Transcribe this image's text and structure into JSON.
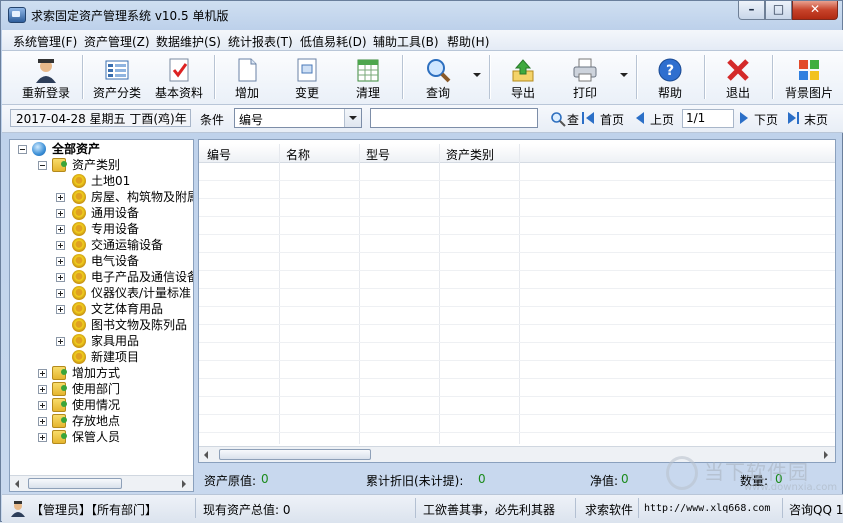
{
  "window": {
    "title": "求索固定资产管理系统 v10.5 单机版",
    "min": "–",
    "max": "□",
    "close": "✕"
  },
  "menu": [
    "系统管理(F)",
    "资产管理(Z)",
    "数据维护(S)",
    "统计报表(T)",
    "低值易耗(D)",
    "辅助工具(B)",
    "帮助(H)"
  ],
  "toolbar": {
    "relogin": "重新登录",
    "asset_class": "资产分类",
    "basic_info": "基本资料",
    "add": "增加",
    "change": "变更",
    "clear": "清理",
    "query": "查询",
    "export": "导出",
    "print": "打印",
    "help": "帮助",
    "exit": "退出",
    "bg_image": "背景图片"
  },
  "filter": {
    "date": "2017-04-28 星期五 丁酉(鸡)年",
    "condition_label": "条件",
    "condition_value": "编号",
    "search_value": "",
    "search_suffix": "查",
    "first": "首页",
    "prev": "上页",
    "page": "1/1",
    "next": "下页",
    "last": "末页"
  },
  "tree": {
    "root": "全部资产",
    "category_group": "资产类别",
    "categories": [
      "土地01",
      "房屋、构筑物及附属",
      "通用设备",
      "专用设备",
      "交通运输设备",
      "电气设备",
      "电子产品及通信设备",
      "仪器仪表/计量标准",
      "文艺体育用品",
      "图书文物及陈列品",
      "家具用品",
      "新建项目"
    ],
    "others": [
      "增加方式",
      "使用部门",
      "使用情况",
      "存放地点",
      "保管人员"
    ]
  },
  "grid": {
    "columns": [
      "编号",
      "名称",
      "型号",
      "资产类别"
    ]
  },
  "summary": {
    "original_label": "资产原值:",
    "original_value": "0",
    "depr_label": "累计折旧(未计提):",
    "depr_value": "0",
    "net_label": "净值:",
    "net_value": "0",
    "qty_label": "数量:",
    "qty_value": "0"
  },
  "status": {
    "user": "【管理员】【所有部门】",
    "total": "现有资产总值: 0",
    "motto": "工欲善其事，必先利其器",
    "brand": "求索软件",
    "url": "http://www.xlq668.com",
    "qq": "咨询QQ 1"
  },
  "watermark": {
    "text": "当下软件园",
    "url": "www.downxia.com"
  },
  "colors": {
    "accent": "#2b6fc7",
    "value_green": "#1a8a1a",
    "close_red": "#c7432a"
  }
}
